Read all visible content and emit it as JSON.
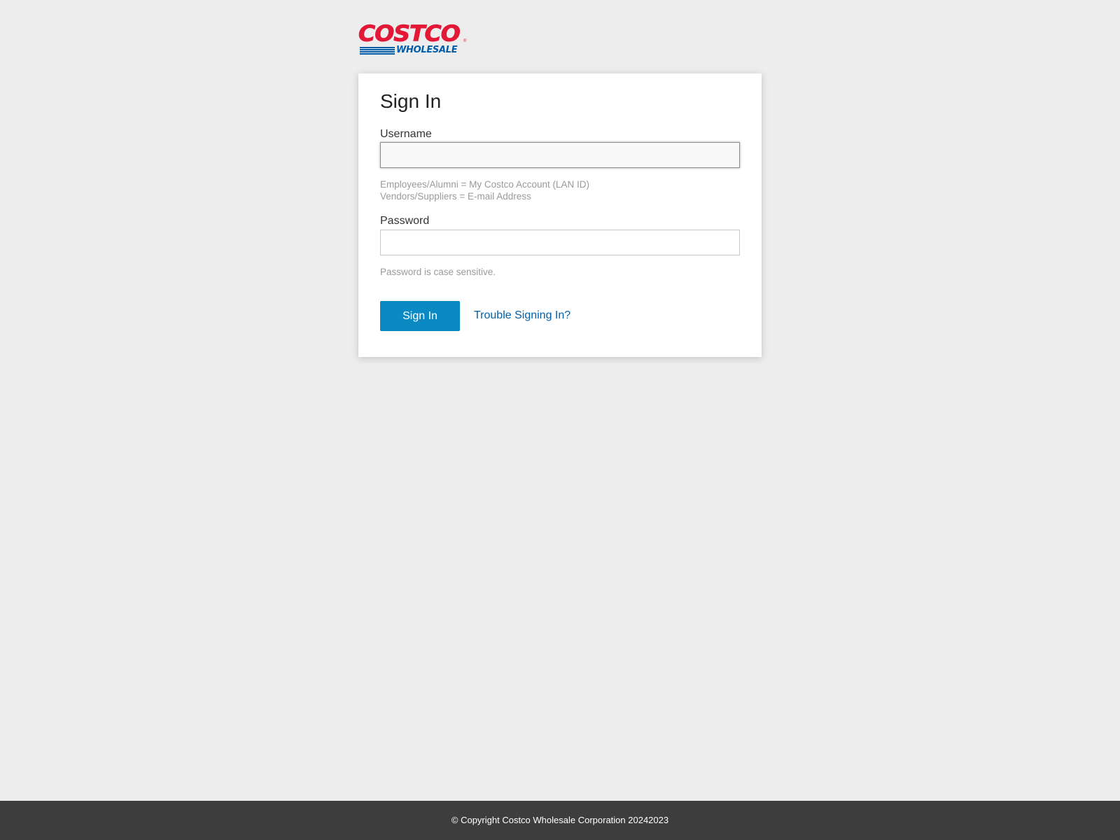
{
  "brand": {
    "logo_top": "COSTCO",
    "logo_bottom": "WHOLESALE",
    "logo_registered": "®",
    "colors": {
      "red": "#e31837",
      "blue": "#005daa"
    }
  },
  "form": {
    "title": "Sign In",
    "username_label": "Username",
    "username_value": "",
    "username_hint_line1": "Employees/Alumni = My Costco Account (LAN ID)",
    "username_hint_line2": "Vendors/Suppliers = E-mail Address",
    "password_label": "Password",
    "password_value": "",
    "password_hint": "Password is case sensitive.",
    "submit_label": "Sign In",
    "trouble_link": "Trouble Signing In?",
    "button_color": "#0b89c2",
    "link_color": "#0060a9"
  },
  "footer": {
    "copyright": "© Copyright Costco Wholesale Corporation 20242023"
  }
}
